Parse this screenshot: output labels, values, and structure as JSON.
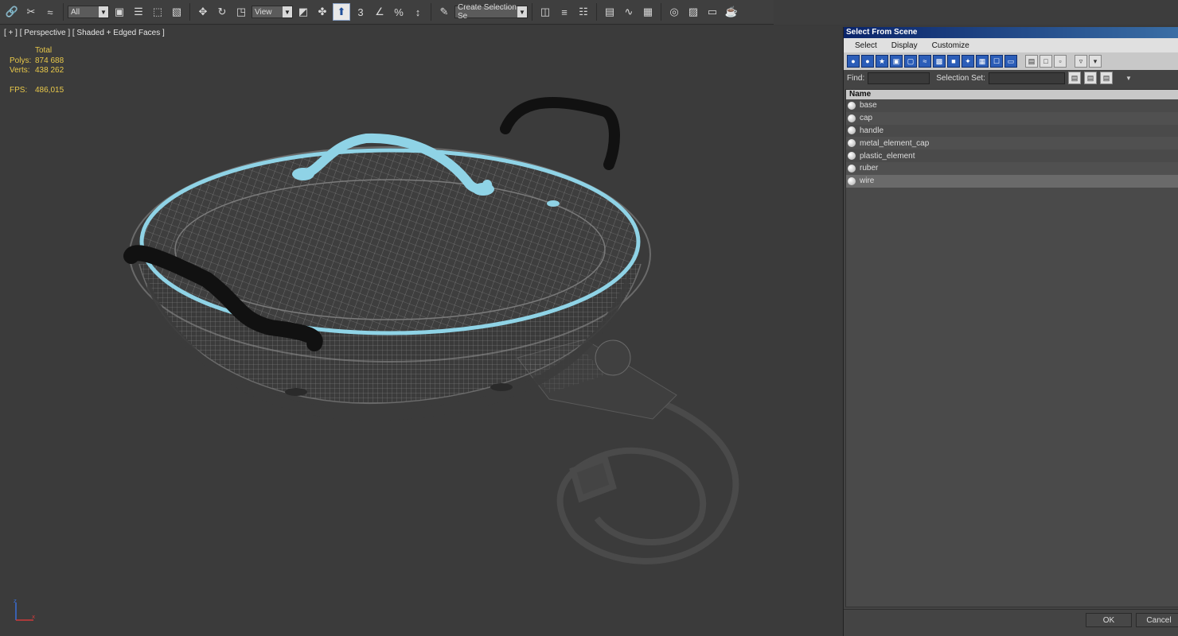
{
  "toolbar": {
    "filter_value": "All",
    "refcoord_value": "View",
    "snap_label": "3",
    "selset_placeholder": "Create Selection Se"
  },
  "viewport": {
    "label": "[ + ] [ Perspective ] [ Shaded + Edged Faces ]",
    "stats": {
      "total_label": "Total",
      "polys_label": "Polys:",
      "polys_value": "874 688",
      "verts_label": "Verts:",
      "verts_value": "438 262",
      "fps_label": "FPS:",
      "fps_value": "486,015"
    }
  },
  "dialog": {
    "title": "Select From Scene",
    "menu": [
      "Select",
      "Display",
      "Customize"
    ],
    "find_label": "Find:",
    "selset_label": "Selection Set:",
    "column_header": "Name",
    "items": [
      "base",
      "cap",
      "handle",
      "metal_element_cap",
      "plastic_element",
      "ruber",
      "wire"
    ],
    "selected_index": 6,
    "ok_label": "OK",
    "cancel_label": "Cancel"
  },
  "colors": {
    "accent_cyan": "#8fd3e6",
    "title_bar": "#0a246a",
    "stats_yellow": "#e8c84a"
  }
}
